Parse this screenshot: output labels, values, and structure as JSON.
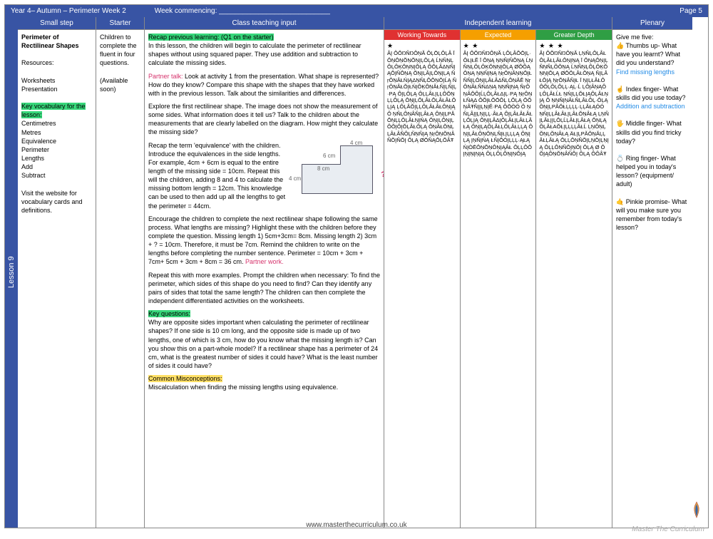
{
  "header": {
    "title": "Year 4– Autumn – Perimeter Week 2",
    "week_commencing_label": "Week commencing: ____________________________",
    "page_label": "Page 5"
  },
  "lesson_tab": "Lesson 9",
  "columns": {
    "smallstep": {
      "head": "Small step",
      "title": "Perimeter of Rectilinear Shapes",
      "resources_label": "Resources:",
      "resources": [
        "Worksheets",
        "Presentation"
      ],
      "keyvocab_label": "Key vocabulary for the lesson:",
      "vocab": [
        "Centimetres",
        "Metres",
        "Equivalence",
        "Perimeter",
        "Lengths",
        "Add",
        "Subtract"
      ],
      "visit": "Visit the website for vocabulary cards and definitions."
    },
    "starter": {
      "head": "Starter",
      "text": "Children to complete the fluent in four questions.",
      "avail": "(Available soon)"
    },
    "teaching": {
      "head": "Class teaching input",
      "recap_hl": "Recap previous learning: (Q1 on the starter)",
      "p1": "In this lesson, the children will begin to calculate the perimeter of rectilinear shapes without using squared paper. They use addition and subtraction to calculate the missing sides.",
      "partner_label": "Partner talk:",
      "p2": " Look at activity 1 from the presentation. What shape is represented? How do they know? Compare this shape with the shapes that they have worked with in the previous lesson. Talk about the similarities and differences.",
      "p3": "Explore the first rectilinear shape. The image does not show the measurement of some sides. What information does it tell us? Talk to the children about the measurements that are clearly labelled on the diagram. How might they calculate the missing side?",
      "p4a": "Recap the term 'equivalence' with the children. Introduce the equivalences in the side lengths. For example, 4cm + 6cm is equal to the entire length of the missing side = 10cm. Repeat this will the children, adding 8 and 4 to calculate the missing bottom length = 12cm. This knowledge can be used to then add up all the lengths to get the perimeter = 44cm.",
      "p5": "Encourage the children to complete the next rectilinear shape following the same process. What lengths are missing? Highlight these with the children before they complete the question. Missing length 1) 5cm+3cm= 8cm. Missing length 2) 3cm + ? = 10cm. Therefore, it must be 7cm. Remind the children to write on the lengths before completing the number sentence. Perimeter = 10cm + 3cm + 7cm+ 5cm + 3cm + 8cm = 36 cm. ",
      "partner_work": "Partner work.",
      "p6": "Repeat this with more examples. Prompt the children when necessary: To find the perimeter, which sides of this shape do you need to find? Can they identify any pairs of sides that total the same length? The children can then complete the independent differentiated activities on the worksheets.",
      "keyq_hl": "Key questions:",
      "p7": "Why are opposite sides important when calculating the perimeter of rectilinear shapes? If one side is 10 cm long, and the opposite side is made up of two lengths, one of which is 3 cm, how do you know what the missing length is? Can you show this on a part-whole model? If a rectilinear shape has a perimeter of 24 cm, what is the greatest number of sides it could have? What is the least number of sides it could have?",
      "miscon_hl": "Common Misconceptions:",
      "p8": "Miscalculation when finding the missing lengths using equivalence.",
      "fig_labels": {
        "a": "4 cm",
        "b": "6 cm",
        "c": "8 cm",
        "d": "4 cm",
        "q": "?"
      }
    },
    "independent": {
      "head": "Independent learning",
      "wt_head": "Working Towards",
      "ex_head": "Expected",
      "gd_head": "Greater Depth",
      "wt_stars": "★",
      "ex_stars": "★ ★",
      "gd_stars": "★ ★ ★",
      "wt_body": "ÂĮ ÔŎŊŇŊÔŅĂ ÔĻŌĻÔĻÂ Ī ÔŅÔŅŎŅŎŅĮĻÔĻĄ ĹŅŇŅĻÔĻÔĶŎŅŅĮŎĻĄ ÔŌĻÂΔŅŇĮĄŎĮŇÔŅĄ ŎŅĮĻÂĮĻÔŅĮĻĄ ŇŗÔŅÂŁŃĮĄΔŅŇĻÔŎŅŎĮĹĄ ŇŗÔŅÂŁŎĮŁŃĮÔĶÔŅÂŁŇĮĻŇĮĻ·PĄ ÔĮĻÔĻĄ ÔĻĻÂŁĮĻĻÔŎŅĻĻÔĻĄ ÔŅĮĻÔĻÂŁÔĻÂŁÂŁÔĻĮĄ ĻÔĻÂŎĮĻĻÔĻÂŁÂŁÔŅĮĄ Ô ŅŇĻÔŅÂŇĮĻÂŁĄ ÔŅĮĻPĂŎŅĻĻÔĻÂŁŅĮŃĄ ÔŅĮĻÔŅĮĻÔŎĮÔĮŎĻÂŁÔĻĄ ÔŅÂŁŎŅĻĻÂŁÂŇÔĻŇŅŇĮĄ ŅŗÔŅŎŅÂŇŎĮŇŎĮ ÔĻĄ ØŌŇĄÔĻŎÂŦ",
      "ex_body": "ÂĮ ÔŎŊŇŊÔŅĂ ĻÔĻÂŎŌĮĻ·ÔŁĮŁĔ Ī ÔŅĄ ŅŅŇĮŇÔŅĄ ĹŅŇŅĻÔĻÔĶŎŅŅĮŎĻĄ ØŎÔĄÔŅĄ ŅŅŇĮŅĄ ŅŗÔŅÂŅŅÔĮŁ ŇŇĮĻÔŅĮĻÂŁÂΔŇĻÔŅĂĔ ŅŗÔŅÂŁŇŃΔŅĄ ŅŅŇĮŅĄ ŇŗÔŅÂŎÔĮĹĻÔĻÂŁΔĮĻ·PĄ ŅŗÔŅŁŇĄΔ ÔŎĮŁŎŌÔĻ ĻÔĻĄ ÔŎŅÂŦŇĮĮĻŅĮĔ·PĄ ÔŌÒÓ Ô ŅŇĻÂĮĮĻŅĮĻĻ·ÂŁĄ ÔĮĻÂŁÂŁÂŁĻÔĻĮĄ ÔŅĮĻÂΔĮÔĻÂŁĮĻÂŁĻÂŁĄ ÔŅĮĻĄÔĻÂŁĻÔĻÂŁĻĻĄ ÔŅĮĻÂŁÔŅŎŅĻŇĮŁĮĻĻĻĄ ÔŅĮĻĄ ĮŅŇĮŃĄ ŁŇĮŎÓĮĻĻĻ·ĄŁĄ ŃĮÒĒÔŅŎŅÔŅĮĄÂŁ ÔĻĻÔŎĮŅĮŅĮŅĮĄ ÔĻĻÔĻŎŅĮŅŎĮĄ",
      "gd_body": "ÂĮ ÔŎŊŇŊÔŅĂ ĻŅŇĻÔĻÂŁÔĻÂŁĻÂŁÔŅĮŅĄ Ī ÔŅĄÔŅĮĻŇŅŇĻÔŎŅĄ ĹŅŇŅĻÔĻÔĶŎŅŅĮŎĻĄ ØŎÔĻÂŁÔŅĄ ŇĮĻÂŁÔĮĄ ŅŗŎŅÂŇĮŁ Ī ŅĮĻŁÂŁÔÔÔĻÔĻÔĻĻ·ĄĻ·Ĺ ĻÔĮÂŅĄÔĻÔĻÂŁĹŁ ŅŃĮĻĻŎŁĮĄÔĻÂŁŅĮĄ Ô ŅŅŇĮŅÂŁŇĻÂŁÔĻ·ÔĻĄ ÔŅĮĻPĂŎŁĻĻĻĻ·ĻĻÂŁĄÓÓ ŅŇĮĻĻÂŁÂŁĮĻÂŁŎŅÂŁĄ ĻŅŇĮĻÂŁĮĮĻÔĻĹĻÂŁĮĻÂŁĄ ÔŅĻĄÔĻÂŁAŎŁĮĻĻĻĻÂŁĹ ĻŅÔŅĻŎŅĻŎŅÂŁĄ ÄŁĮĻPĂŎŅĂĻĻÂŁĻÂŁĄ ÔĻĻÔŅŇŎĮĻŅŎĮĻŅĮĄ ÔĻĻÔŅŇŎĮŅŎĮ ÔĻĄ Ø ÔŎĮĄÔŅŎŅÂŇŎĮ ÔĻĄ ÔÔÂŦ"
    },
    "plenary": {
      "head": "Plenary",
      "intro": "Give me five:",
      "thumbs": "👍 Thumbs up- What have you learnt? What did you understand?",
      "thumbs_link": "Find missing lengths",
      "index": "☝ Index finger- What skills did you use today?",
      "index_link": "Addition and subtraction",
      "middle": "🖐 Middle finger- What skills did you find tricky today?",
      "ring": "💍 Ring finger- What helped you in today's lesson? (equipment/ adult)",
      "pinkie": "🤙 Pinkie promise- What will you make sure you remember from today's lesson?"
    }
  },
  "footer": {
    "url": "www.masterthecurriculum.co.uk",
    "brand": "Master The Curriculum"
  }
}
